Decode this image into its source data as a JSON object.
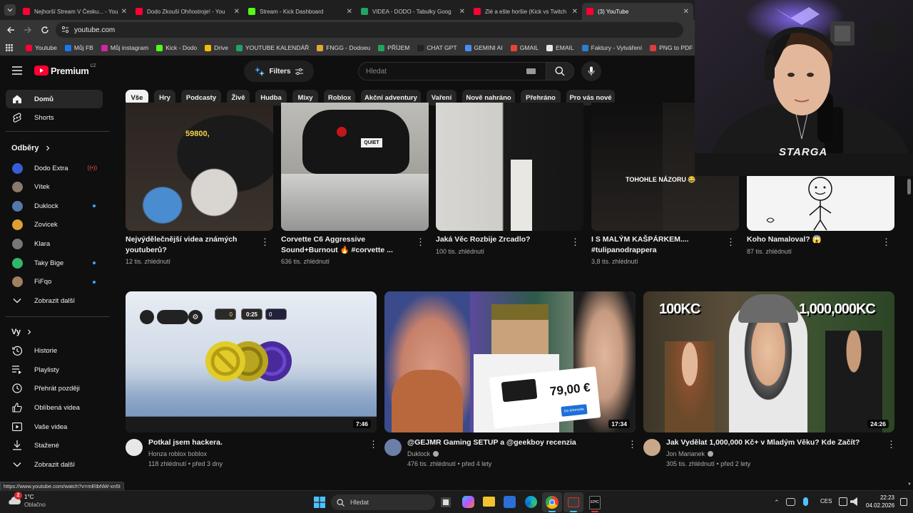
{
  "browser": {
    "tabs": [
      {
        "title": "Nejhorší Stream V Česku... - You",
        "color": "#ff0033"
      },
      {
        "title": "Dodo Zkouší Ohňostroje! - You",
        "color": "#ff0033"
      },
      {
        "title": "Stream - Kick Dashboard",
        "color": "#53fc18"
      },
      {
        "title": "VIDEA - DODO - Tabulky Goog",
        "color": "#1fa463"
      },
      {
        "title": "Zlé a ešte horšie (Kick vs Twitch",
        "color": "#ff0033"
      },
      {
        "title": "(3) YouTube",
        "color": "#ff0033"
      }
    ],
    "url": "youtube.com",
    "bookmarks": [
      {
        "label": "Youtube",
        "color": "#ff0033"
      },
      {
        "label": "Můj FB",
        "color": "#1877f2"
      },
      {
        "label": "Můj instagram",
        "color": "#d6249f"
      },
      {
        "label": "Kick - Dodo",
        "color": "#53fc18"
      },
      {
        "label": "Drive",
        "color": "#fbbc04"
      },
      {
        "label": "YOUTUBE KALENDÁŘ",
        "color": "#1fa463"
      },
      {
        "label": "FNGG - Dodoeu",
        "color": "#e8a33d"
      },
      {
        "label": "PŘÍJEM",
        "color": "#1fa463"
      },
      {
        "label": "CHAT GPT",
        "color": "#222222"
      },
      {
        "label": "GEMINI AI",
        "color": "#4c8bf5"
      },
      {
        "label": "GMAIL",
        "color": "#ea4335"
      },
      {
        "label": "EMAIL",
        "color": "#e8e8e8"
      },
      {
        "label": "Faktury - Vytváření",
        "color": "#2a7fd4"
      },
      {
        "label": "PNG to PDF",
        "color": "#e03c3c"
      }
    ]
  },
  "header": {
    "logo": "Premium",
    "logo_region": "CZ",
    "filters_label": "Filters",
    "search_placeholder": "Hledat"
  },
  "chips": [
    "Vše",
    "Hry",
    "Podcasty",
    "Živě",
    "Hudba",
    "Mixy",
    "Roblox",
    "Akční adventury",
    "Vaření",
    "Nově nahráno",
    "Přehráno",
    "Pro vás nové"
  ],
  "sidebar": {
    "home": "Domů",
    "shorts": "Shorts",
    "subs_title": "Odběry",
    "subs": [
      {
        "name": "Dodo Extra",
        "color": "#3a5bd9",
        "live": true,
        "dot": false
      },
      {
        "name": "Vítek",
        "color": "#8a7a6a",
        "live": false,
        "dot": false
      },
      {
        "name": "Duklock",
        "color": "#5577aa",
        "live": false,
        "dot": true
      },
      {
        "name": "Zovicek",
        "color": "#e0a030",
        "live": false,
        "dot": false
      },
      {
        "name": "Klara",
        "color": "#777777",
        "live": false,
        "dot": false
      },
      {
        "name": "Taky Bige",
        "color": "#2fb86a",
        "live": false,
        "dot": true
      },
      {
        "name": "FiFqo",
        "color": "#a08060",
        "live": false,
        "dot": true
      }
    ],
    "show_more": "Zobrazit další",
    "you_title": "Vy",
    "you_items": [
      "Historie",
      "Playlisty",
      "Přehrát později",
      "Oblíbená videa",
      "Vaše videa",
      "Stažené",
      "Zobrazit další"
    ]
  },
  "row1": [
    {
      "title1": "Nejvýdělečnější videa známých",
      "title2": "youtuberů?",
      "meta": "12 tis. zhlédnutí",
      "overlay": "59800,"
    },
    {
      "title1": "Corvette C6 Aggressive",
      "title2": "Sound+Burnout 🔥 #corvette ...",
      "meta": "636 tis. zhlédnutí",
      "overlay": "QUIET"
    },
    {
      "title1": "Jaká Věc Rozbije Zrcadlo?",
      "title2": "",
      "meta": "100 tis. zhlédnutí",
      "overlay": ""
    },
    {
      "title1": "I S MALÝM KAŠPÁRKEM....",
      "title2": "#tulipanodrappera",
      "meta": "3,8 tis. zhlédnutí",
      "overlay": "TOHOHLE NÁZORU 😂"
    },
    {
      "title1": "Koho Namaloval? 😱",
      "title2": "",
      "meta": "87 tis. zhlédnutí",
      "overlay": ""
    }
  ],
  "row2": [
    {
      "title": "Potkal jsem hackera.",
      "channel": "Honza roblox boblox",
      "verified": false,
      "meta": "118 zhlédnutí • před 3 dny",
      "duration": "7:46",
      "hud_time": "0:25",
      "hud_left": "0",
      "hud_right": "0"
    },
    {
      "title": "@GEJMR Gaming SETUP a @geekboy recenzia",
      "channel": "Duklock",
      "verified": true,
      "meta": "476 tis. zhlédnutí • před 4 lety",
      "duration": "17:34",
      "price": "79,00 €",
      "tag": "Do kŕemcele"
    },
    {
      "title": "Jak Vydělat 1,000,000 Kč+ v Mladým Věku? Kde Začít?",
      "channel": "Jon Marianek",
      "verified": true,
      "meta": "305 tis. zhlédnutí • před 2 lety",
      "duration": "24:26",
      "left_text": "100KC",
      "right_text": "1,000,000KC"
    }
  ],
  "status_url": "https://www.youtube.com/watch?v=mEtbNW-xn5I",
  "taskbar": {
    "weather_temp": "1°C",
    "weather_desc": "Oblačno",
    "weather_badge": "2",
    "search": "Hledat",
    "lang": "CES",
    "time": "22:23",
    "date": "04.02.2026"
  },
  "webcam": {
    "shirt_text": "STARGA"
  }
}
